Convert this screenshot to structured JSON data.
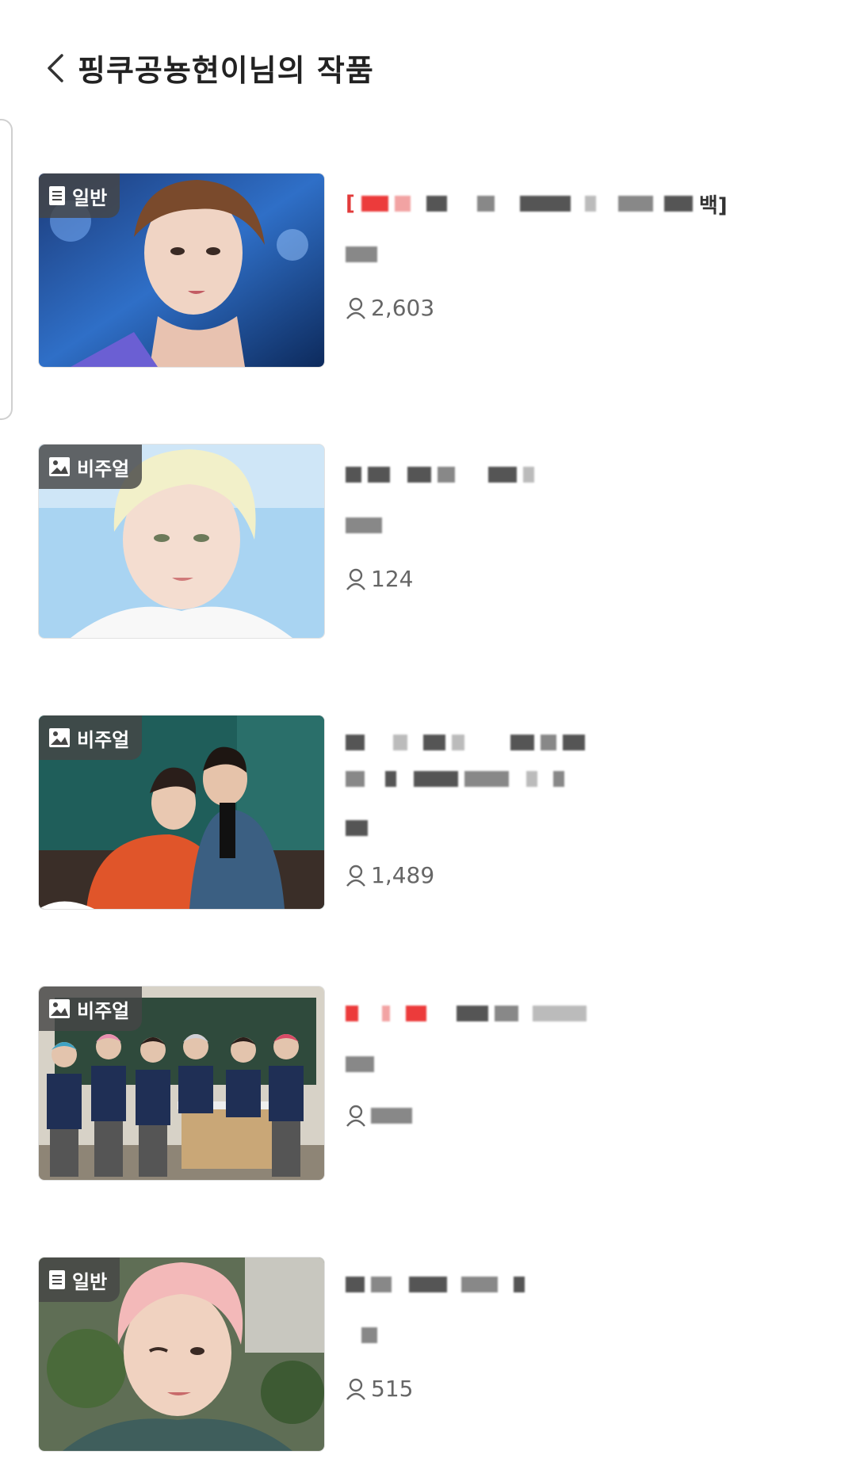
{
  "header": {
    "title": "핑쿠공뇽현이님의 작품",
    "back_icon": "chevron-left-icon"
  },
  "colors": {
    "badge_bg": "#464646",
    "title_red": "#e23b3b",
    "text_gray": "#666666"
  },
  "works": [
    {
      "badge_label": "일반",
      "badge_icon": "document-icon",
      "title_start": "[",
      "title_end": "백]",
      "readers": "2,603",
      "thumb_desc": "portrait-blue-stage"
    },
    {
      "badge_label": "비주얼",
      "badge_icon": "image-icon",
      "readers": "124",
      "thumb_desc": "portrait-blonde-light-blue"
    },
    {
      "badge_label": "비주얼",
      "badge_icon": "image-icon",
      "readers": "1,489",
      "thumb_desc": "two-people-green-wall"
    },
    {
      "badge_label": "비주얼",
      "badge_icon": "image-icon",
      "readers": "",
      "thumb_desc": "group-classroom"
    },
    {
      "badge_label": "일반",
      "badge_icon": "document-icon",
      "readers": "515",
      "thumb_desc": "pink-hair-selfie"
    }
  ]
}
